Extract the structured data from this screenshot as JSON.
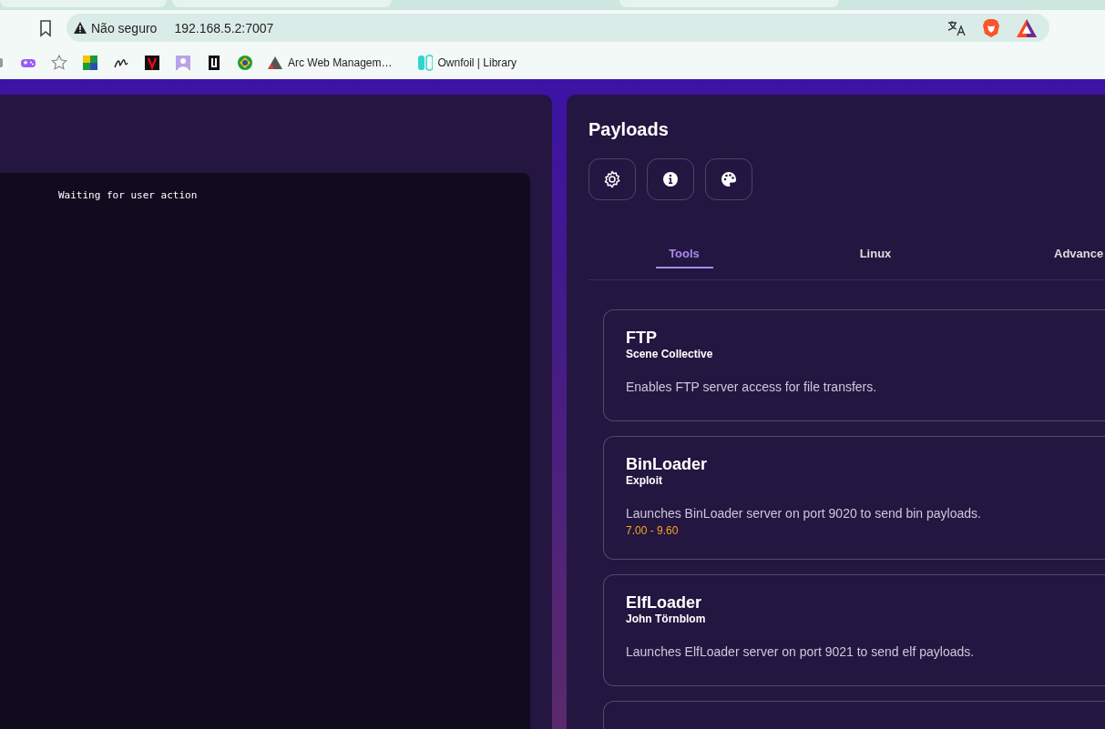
{
  "browser": {
    "address_bar": {
      "security_label": "Não seguro",
      "url": "192.168.5.2:7007"
    },
    "bookmarks": [
      {
        "label": "Arc Web Managem…"
      },
      {
        "label": "Ownfoil | Library"
      }
    ]
  },
  "console": {
    "lines": [
      "Waiting for user action"
    ]
  },
  "payloads": {
    "title": "Payloads",
    "tabs": [
      {
        "label": "Tools",
        "selected": true
      },
      {
        "label": "Linux",
        "selected": false
      },
      {
        "label": "Advance",
        "selected": false
      }
    ],
    "cards": [
      {
        "name": "FTP",
        "author": "Scene Collective",
        "description": "Enables FTP server access for file transfers."
      },
      {
        "name": "BinLoader",
        "author": "Exploit",
        "description": "Launches BinLoader server on port 9020 to send bin payloads.",
        "versions": "7.00 - 9.60"
      },
      {
        "name": "ElfLoader",
        "author": "John Törnblom",
        "description": "Launches ElfLoader server on port 9021 to send elf payloads."
      }
    ]
  }
}
